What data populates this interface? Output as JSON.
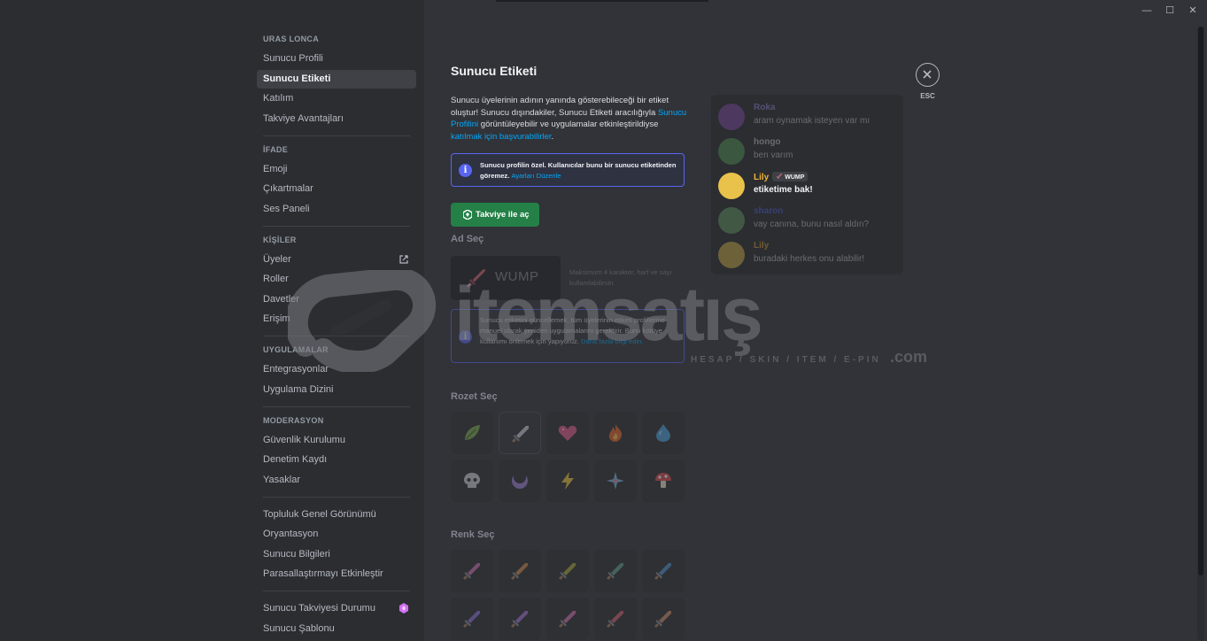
{
  "window": {
    "minimize": "—",
    "maximize": "☐",
    "close": "✕"
  },
  "sidebar": {
    "sections": [
      {
        "header": "URAS LONCA",
        "items": [
          "Sunucu Profili",
          "Sunucu Etiketi",
          "Katılım",
          "Takviye Avantajları"
        ]
      },
      {
        "header": "İFADE",
        "items": [
          "Emoji",
          "Çıkartmalar",
          "Ses Paneli"
        ]
      },
      {
        "header": "KİŞİLER",
        "items": [
          "Üyeler",
          "Roller",
          "Davetler",
          "Erişim"
        ]
      },
      {
        "header": "UYGULAMALAR",
        "items": [
          "Entegrasyonlar",
          "Uygulama Dizini"
        ]
      },
      {
        "header": "MODERASYON",
        "items": [
          "Güvenlik Kurulumu",
          "Denetim Kaydı",
          "Yasaklar"
        ]
      },
      {
        "header": "",
        "items": [
          "Topluluk Genel Görünümü",
          "Oryantasyon",
          "Sunucu Bilgileri",
          "Parasallaştırmayı Etkinleştir"
        ]
      },
      {
        "header": "",
        "items": [
          "Sunucu Takviyesi Durumu",
          "Sunucu Şablonu"
        ]
      }
    ],
    "active_item": "Sunucu Etiketi"
  },
  "main": {
    "title": "Sunucu Etiketi",
    "desc_1": "Sunucu üyelerinin adının yanında gösterebileceği bir etiket oluştur! Sunucu dışındakiler, Sunucu Etiketi aracılığıyla ",
    "desc_link_1": "Sunucu Profilini",
    "desc_2": " görüntüleyebilir ve uygulamalar etkinleştirildiyse ",
    "desc_link_2": "katılmak için başvurabilirler",
    "desc_3": ".",
    "info_text": "Sunucu profilin özel. Kullanıcılar bunu bir sunucu etiketinden göremez. ",
    "info_link": "Ayarları Düzenle",
    "boost_button": "Takviye ile aç",
    "name_label": "Ad Seç",
    "name_value": "WUMP",
    "name_hint": "Maksimum 4 karakter, harf ve sayı kullanılabilirsin.",
    "warn_text": "Sunucu etiketini güncellemek, tüm üyelerinin etiketi profillerine manuel olarak yeniden uygulamalarını gerektirir. Bunu kötüye kullanımı önlemek için yapıyoruz. ",
    "warn_link": "Daha fazla bilgi edin.",
    "badge_label": "Rozet Seç",
    "color_label": "Renk Seç",
    "badges": [
      "leaf-icon",
      "sword-icon",
      "heart-icon",
      "fire-icon",
      "water-drop-icon",
      "skull-icon",
      "moon-icon",
      "lightning-icon",
      "sparkle-icon",
      "mushroom-icon"
    ],
    "colors": [
      "#c96fb0",
      "#c9894d",
      "#a8a53b",
      "#5e9c8f",
      "#4f8fc9",
      "#8a6fd6",
      "#a56fd0",
      "#d06fae",
      "#d2606b",
      "#c98a6a"
    ]
  },
  "close": {
    "label": "ESC"
  },
  "preview": {
    "messages": [
      {
        "name": "Roka",
        "text": "aram oynamak isteyen var mı",
        "name_color": "#a68cf0",
        "avatar_color": "#8e4fb8"
      },
      {
        "name": "hongo",
        "text": "ben varım",
        "name_color": "#dbdee1",
        "avatar_color": "#5aa55a"
      },
      {
        "name": "Lily",
        "tag": "WUMP",
        "text": "etiketime bak!",
        "name_color": "#f0b232",
        "avatar_color": "#e8c24a"
      },
      {
        "name": "sharon",
        "text": "vay canına, bunu nasıl aldın?",
        "name_color": "#5865f2",
        "avatar_color": "#6aa86a"
      },
      {
        "name": "Lily",
        "text": "buradaki herkes onu alabilir!",
        "name_color": "#f0b232",
        "avatar_color": "#e8c24a"
      }
    ]
  },
  "watermark": {
    "brand": "itemsatış",
    "tagline": "HESAP / SKIN / ITEM / E-PIN",
    "suffix": ".com"
  }
}
